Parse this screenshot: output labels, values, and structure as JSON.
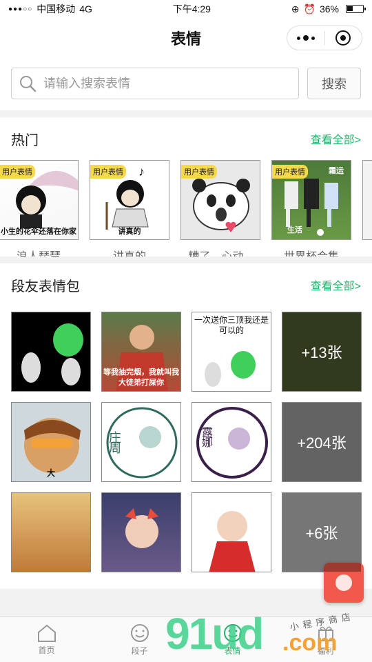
{
  "status_bar": {
    "carrier": "中国移动",
    "network": "4G",
    "time": "下午4:29",
    "battery": "36%",
    "battery_level": 0.36
  },
  "nav": {
    "title": "表情"
  },
  "search": {
    "placeholder": "请输入搜索表情",
    "button": "搜索"
  },
  "hot": {
    "title": "热门",
    "see_all": "查看全部>",
    "items": [
      {
        "tag": "用户表情",
        "caption": "小生的花伞还落在你家",
        "name": "浪人琵琶"
      },
      {
        "tag": "用户表情",
        "caption": "讲真的",
        "name": "讲真的"
      },
      {
        "tag": "用户表情",
        "caption": "",
        "name": "糟了，心动..."
      },
      {
        "tag": "用户表情",
        "caption": "生活",
        "caption2": "霜运",
        "name": "世界杯合集"
      }
    ]
  },
  "packs": {
    "title": "段友表情包",
    "see_all": "查看全部>",
    "rows": [
      [
        {
          "caption": "",
          "count": ""
        },
        {
          "caption": "等我抽完烟，我就叫我大徒弟打屎你",
          "count": ""
        },
        {
          "caption": "一次送你三顶我还是可以的",
          "count": ""
        },
        {
          "caption": "",
          "count": "+13张"
        }
      ],
      [
        {
          "caption": "大",
          "count": ""
        },
        {
          "caption": "庄周",
          "count": ""
        },
        {
          "caption": "露娜",
          "count": ""
        },
        {
          "caption": "",
          "count": "+204张"
        }
      ],
      [
        {
          "caption": "",
          "count": ""
        },
        {
          "caption": "",
          "count": ""
        },
        {
          "caption": "",
          "count": ""
        },
        {
          "caption": "",
          "count": "+6张"
        }
      ]
    ]
  },
  "tabs": [
    {
      "label": "首页",
      "icon": "home-icon",
      "active": false
    },
    {
      "label": "段子",
      "icon": "smile-icon",
      "active": false
    },
    {
      "label": "表情",
      "icon": "emoji-icon",
      "active": true
    },
    {
      "label": "福利",
      "icon": "gift-icon",
      "active": false
    }
  ],
  "watermark": {
    "main": "91ud",
    "suffix": ".com",
    "shop": "小程序商店"
  },
  "colors": {
    "accent": "#21b36b",
    "tag": "#f4d94b",
    "fab": "#f15a4a"
  }
}
